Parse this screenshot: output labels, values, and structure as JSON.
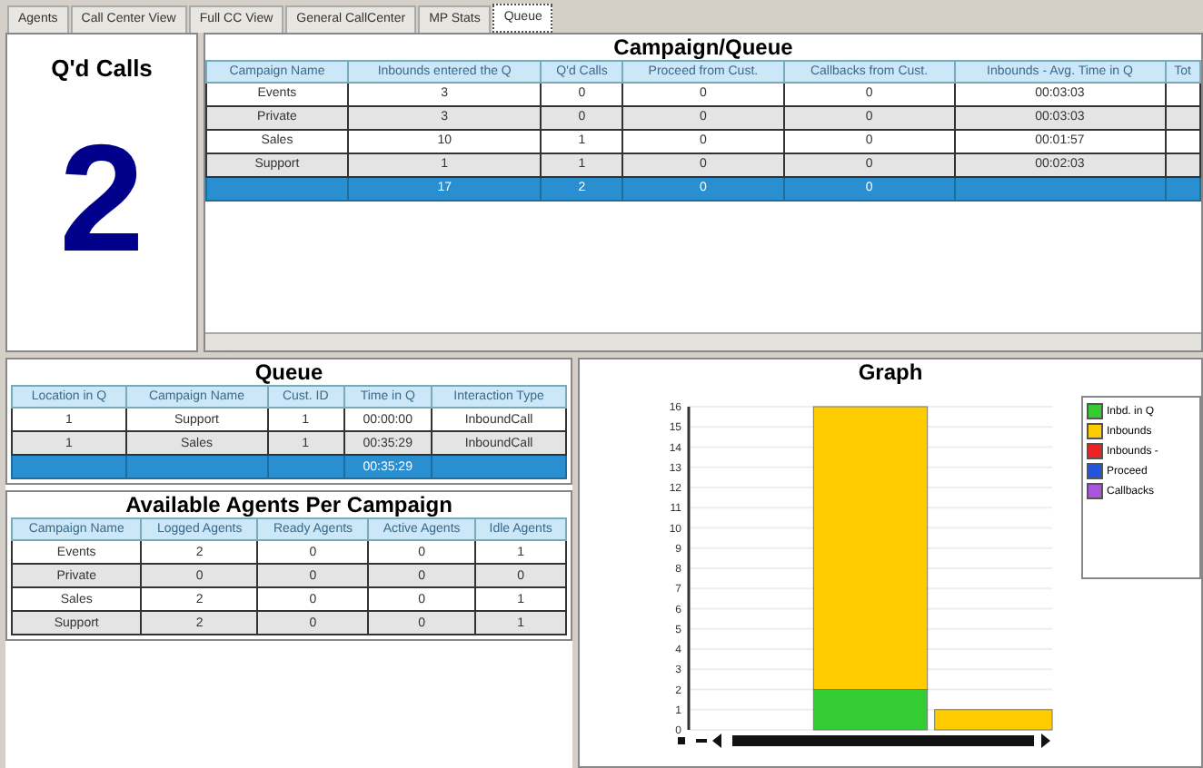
{
  "tabs": [
    {
      "label": "Agents",
      "selected": false
    },
    {
      "label": "Call Center View",
      "selected": false
    },
    {
      "label": "Full CC View",
      "selected": false
    },
    {
      "label": "General CallCenter",
      "selected": false
    },
    {
      "label": "MP Stats",
      "selected": false
    },
    {
      "label": "Queue",
      "selected": true
    }
  ],
  "qd_calls": {
    "title": "Q'd Calls",
    "count": "2"
  },
  "campaign_queue": {
    "title": "Campaign/Queue",
    "columns": [
      "Campaign Name",
      "Inbounds entered the Q",
      "Q'd Calls",
      "Proceed from Cust.",
      "Callbacks from Cust.",
      "Inbounds - Avg. Time in Q",
      "Tot"
    ],
    "rows": [
      [
        "Events",
        "3",
        "0",
        "0",
        "0",
        "00:03:03"
      ],
      [
        "Private",
        "3",
        "0",
        "0",
        "0",
        "00:03:03"
      ],
      [
        "Sales",
        "10",
        "1",
        "0",
        "0",
        "00:01:57"
      ],
      [
        "Support",
        "1",
        "1",
        "0",
        "0",
        "00:02:03"
      ]
    ],
    "total": {
      "inbounds_entered": "17",
      "qd_calls": "2",
      "proceed_from_cust": "0",
      "callbacks_from_cust": "0"
    }
  },
  "queue": {
    "title": "Queue",
    "columns": [
      "Location in Q",
      "Campaign Name",
      "Cust. ID",
      "Time in Q",
      "Interaction Type"
    ],
    "rows": [
      [
        "1",
        "Support",
        "1",
        "00:00:00",
        "InboundCall"
      ],
      [
        "1",
        "Sales",
        "1",
        "00:35:29",
        "InboundCall"
      ]
    ],
    "total": {
      "time_in_q": "00:35:29"
    }
  },
  "agents": {
    "title": "Available Agents Per Campaign",
    "columns": [
      "Campaign Name",
      "Logged Agents",
      "Ready Agents",
      "Active Agents",
      "Idle Agents"
    ],
    "rows": [
      [
        "Events",
        "2",
        "0",
        "0",
        "1"
      ],
      [
        "Private",
        "0",
        "0",
        "0",
        "0"
      ],
      [
        "Sales",
        "2",
        "0",
        "0",
        "1"
      ],
      [
        "Support",
        "2",
        "0",
        "0",
        "1"
      ]
    ]
  },
  "graph": {
    "title": "Graph",
    "chart_data": {
      "type": "bar",
      "stacked": true,
      "grid": true,
      "legend": true,
      "ylim": [
        0,
        16
      ],
      "yticks": [
        0,
        1,
        2,
        3,
        4,
        5,
        6,
        7,
        8,
        9,
        10,
        11,
        12,
        13,
        14,
        15,
        16
      ],
      "series": [
        {
          "name": "Inbd. in Q",
          "color": "#33cc33",
          "values": [
            null,
            2,
            null
          ]
        },
        {
          "name": "Inbounds",
          "color": "#ffcc00",
          "values": [
            null,
            14,
            1
          ]
        },
        {
          "name": "Inbounds -",
          "color": "#ee2222",
          "values": [
            null,
            null,
            null
          ]
        },
        {
          "name": "Proceed",
          "color": "#2255dd",
          "values": [
            null,
            null,
            null
          ]
        },
        {
          "name": "Callbacks",
          "color": "#aa55dd",
          "values": [
            null,
            null,
            null
          ]
        }
      ]
    }
  }
}
